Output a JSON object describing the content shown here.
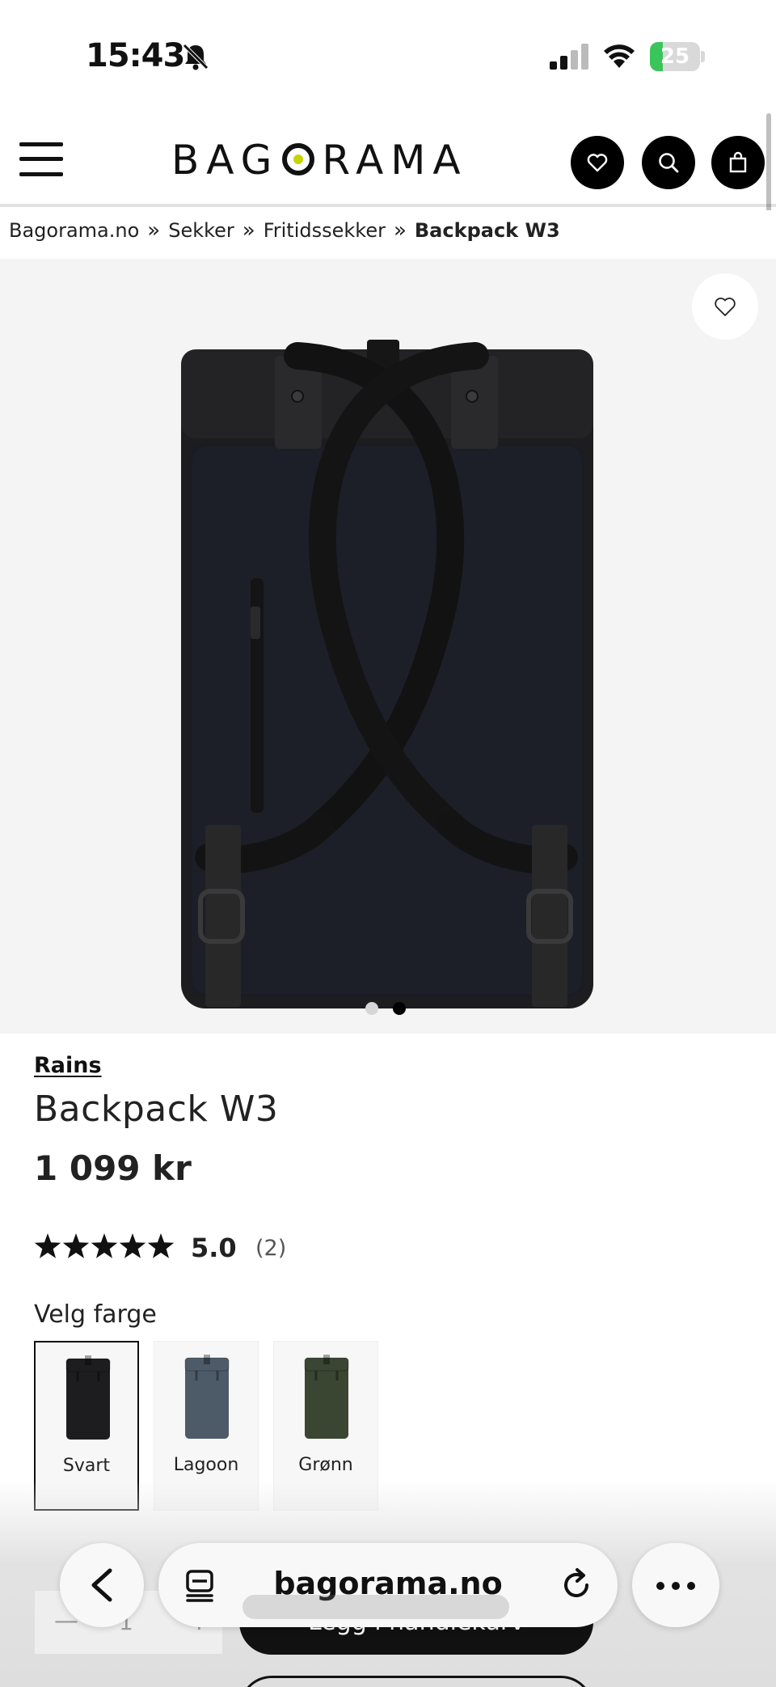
{
  "status_bar": {
    "time": "15:43",
    "battery_level": "25",
    "battery_fraction": 0.25,
    "icons": [
      "bell-slash-icon",
      "signal-icon",
      "wifi-icon",
      "battery-icon"
    ]
  },
  "header": {
    "logo_text_left": "BAG",
    "logo_text_right": "RAMA",
    "icons": [
      "menu-icon",
      "heart-icon",
      "search-icon",
      "shopping-bag-icon"
    ],
    "accent_color": "#c8d400"
  },
  "breadcrumb": {
    "items": [
      "Bagorama.no",
      "Sekker",
      "Fritidssekker",
      "Backpack W3"
    ],
    "separator": "»"
  },
  "gallery": {
    "image_count": 2,
    "active_index": 1,
    "product_color": "#1b1b1d"
  },
  "product": {
    "brand": "Rains",
    "title": "Backpack W3",
    "price": "1 099 kr",
    "rating_value": "5.0",
    "rating_count": "(2)",
    "stars": 5
  },
  "colors": {
    "heading": "Velg farge",
    "options": [
      {
        "label": "Svart",
        "hex": "#1d1d20",
        "selected": true
      },
      {
        "label": "Lagoon",
        "hex": "#4d5b68",
        "selected": false
      },
      {
        "label": "Grønn",
        "hex": "#3a4532",
        "selected": false
      }
    ]
  },
  "purchase": {
    "quantity_minus": "—",
    "quantity": "1",
    "quantity_plus": "+",
    "add_to_cart": "Legg i handlekurv"
  },
  "browser": {
    "url": "bagorama.no",
    "icons": [
      "back-arrow-icon",
      "tabs-icon",
      "reload-icon",
      "more-icon"
    ]
  }
}
